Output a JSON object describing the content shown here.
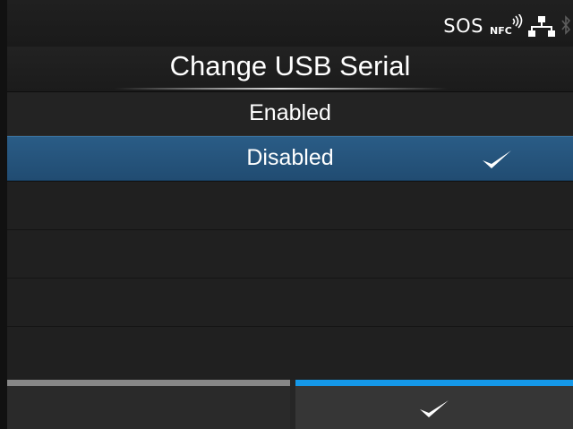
{
  "status": {
    "sos_label": "SOS",
    "icons": [
      "nfc-icon",
      "lan-icon",
      "bluetooth-icon"
    ]
  },
  "screen": {
    "title": "Change USB Serial"
  },
  "options": [
    {
      "label": "Enabled",
      "selected": false
    },
    {
      "label": "Disabled",
      "selected": true
    }
  ],
  "footer": {
    "left_button": "",
    "right_button_icon": "checkmark-icon"
  },
  "colors": {
    "selected_row": "#245178",
    "confirm_accent": "#1598e8",
    "back_accent": "#878787"
  }
}
